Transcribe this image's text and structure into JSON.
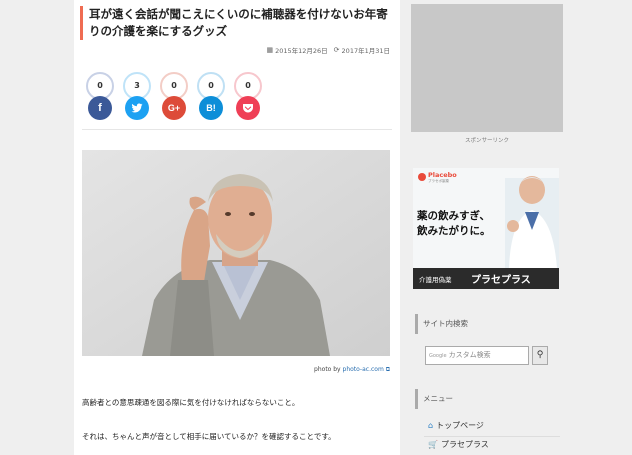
{
  "article": {
    "title": "耳が遠く会話が聞こえにくいのに補聴器を付けないお年寄りの介護を楽にするグッズ",
    "date_posted": "2015年12月26日",
    "date_updated": "2017年1月31日",
    "calendar_icon": "calendar-icon",
    "update_icon": "refresh-icon",
    "share": [
      {
        "name": "facebook",
        "count": "0",
        "glyph": "f",
        "color": "#3b5998",
        "ring": "#c8d1e6"
      },
      {
        "name": "twitter",
        "count": "3",
        "glyph": "🐦",
        "color": "#1da1f2",
        "ring": "#bfe3f8"
      },
      {
        "name": "googleplus",
        "count": "0",
        "glyph": "G+",
        "color": "#dd4b39",
        "ring": "#f3cdc6"
      },
      {
        "name": "hatena",
        "count": "0",
        "glyph": "B!",
        "color": "#0d8ed8",
        "ring": "#bfe0f4"
      },
      {
        "name": "pocket",
        "count": "0",
        "glyph": "❤",
        "color": "#ef3f56",
        "ring": "#f7c7cd"
      }
    ],
    "credit_prefix": "photo by ",
    "credit_link": "photo-ac.com",
    "paragraph1": "高齢者との意思疎通を図る際に気を付けなければならないこと。",
    "paragraph2": "それは、ちゃんと声が音として相手に届いているか？を確認することです。"
  },
  "sidebar": {
    "sponsor_label": "スポンサーリンク",
    "banner": {
      "brand": "Placebo",
      "brand_sub": "プラセボ製薬",
      "headline1": "薬の飲みすぎ、",
      "headline2": "飲みたがりに。",
      "footer_small": "介護用偽薬",
      "footer_big": "プラセプラス"
    },
    "search_title": "サイト内検索",
    "search_google": "Google",
    "search_placeholder": "カスタム検索",
    "menu_title": "メニュー",
    "menu_items": [
      {
        "label": "トップページ",
        "icon": "home-icon"
      },
      {
        "label": "プラセプラス",
        "icon": "cart-icon"
      }
    ]
  }
}
